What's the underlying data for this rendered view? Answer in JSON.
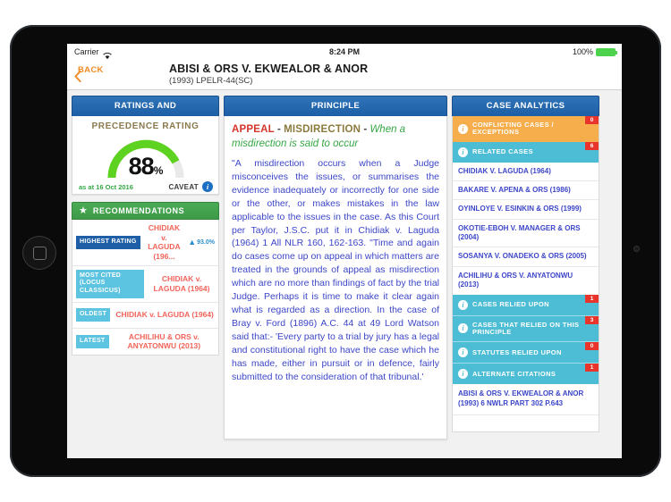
{
  "status_bar": {
    "carrier": "Carrier",
    "wifi_icon": "wifi-icon",
    "time": "8:24 PM",
    "battery_percent": "100%",
    "battery_icon": "battery-full-icon"
  },
  "navbar": {
    "back_label": "BACK",
    "back_icon": "chevron-left-icon",
    "title": "ABISI & ORS V. EKWEALOR & ANOR",
    "subtitle": "(1993) LPELR-44(SC)"
  },
  "left_panel": {
    "header": "RATINGS AND RECOMMENDATIONS",
    "rating": {
      "title": "PRECEDENCE RATING",
      "value": "88",
      "percent_symbol": "%",
      "value_number": 88,
      "as_at": "as at 16 Oct 2016",
      "caveat_label": "CAVEAT",
      "info_icon": "info-icon",
      "arc_color": "#5ed220"
    },
    "recommendations": {
      "header": "RECOMMENDATIONS",
      "star_icon": "star-icon",
      "rows": [
        {
          "tag": "HIGHEST RATING",
          "tag_style": "dark",
          "case": "CHIDIAK v.",
          "case2": "LAGUDA (196...",
          "rating_arrow": "▲",
          "rating_value": "93.0%"
        },
        {
          "tag": "MOST CITED (LOCUS CLASSICUS)",
          "tag_style": "light",
          "case": "CHIDIAK v.",
          "case2": "LAGUDA (1964)",
          "rating_arrow": "",
          "rating_value": ""
        },
        {
          "tag": "OLDEST",
          "tag_style": "light",
          "case": "CHIDIAK v. LAGUDA (1964)",
          "case2": "",
          "rating_arrow": "",
          "rating_value": ""
        },
        {
          "tag": "LATEST",
          "tag_style": "light",
          "case": "ACHILIHU & ORS v.",
          "case2": "ANYATONWU (2013)",
          "rating_arrow": "",
          "rating_value": ""
        }
      ]
    }
  },
  "middle_panel": {
    "header": "PRINCIPLE",
    "heading_kw1": "APPEAL",
    "heading_dash1": " - ",
    "heading_kw2": "MISDIRECTION",
    "heading_dash2": " - ",
    "heading_kw3": "When a misdirection is said to occur",
    "body": "\"A misdirection occurs when a Judge misconceives the issues, or summarises the evidence inadequately or incorrectly for one side or the other, or makes mistakes in the law applicable to the issues in the case. As this Court per Taylor, J.S.C. put it in Chidiak v. Laguda (1964) 1 All NLR 160, 162-163. \"Time and again do cases come up on appeal in which matters are treated in the grounds of appeal as misdirection which are no more than findings of fact by the trial Judge. Perhaps it is time to make it clear again what is regarded as a direction. In the case of Bray v. Ford (1896) A.C. 44 at 49 Lord Watson said that:- 'Every party to a trial by jury has a legal and constitutional right to have the case which he has made, either in pursuit or in defence, fairly submitted to the consideration of that tribunal.'"
  },
  "right_panel": {
    "header": "CASE ANALYTICS",
    "conflicting": {
      "label": "CONFLICTING CASES / EXCEPTIONS",
      "count": "0",
      "info_icon": "info-icon"
    },
    "related": {
      "label": "RELATED CASES",
      "count": "6",
      "info_icon": "info-icon"
    },
    "related_cases": [
      "CHIDIAK V. LAGUDA (1964)",
      "BAKARE V. APENA & ORS (1986)",
      "OYINLOYE V. ESINKIN & ORS (1999)",
      "OKOTIE-EBOH V. MANAGER & ORS (2004)",
      "SOSANYA V. ONADEKO & ORS (2005)",
      "ACHILIHU & ORS V. ANYATONWU (2013)"
    ],
    "sections": [
      {
        "label": "CASES RELIED UPON",
        "count": "1",
        "info_icon": "info-icon"
      },
      {
        "label": "CASES THAT RELIED ON THIS PRINCIPLE",
        "count": "3",
        "info_icon": "info-icon"
      },
      {
        "label": "STATUTES RELIED UPON",
        "count": "0",
        "info_icon": "info-icon"
      },
      {
        "label": "ALTERNATE CITATIONS",
        "count": "1",
        "info_icon": "info-icon"
      }
    ],
    "alternate_citation": "ABISI & ORS V. EKWEALOR & ANOR (1993) 6 NWLR PART 302 P.643"
  }
}
